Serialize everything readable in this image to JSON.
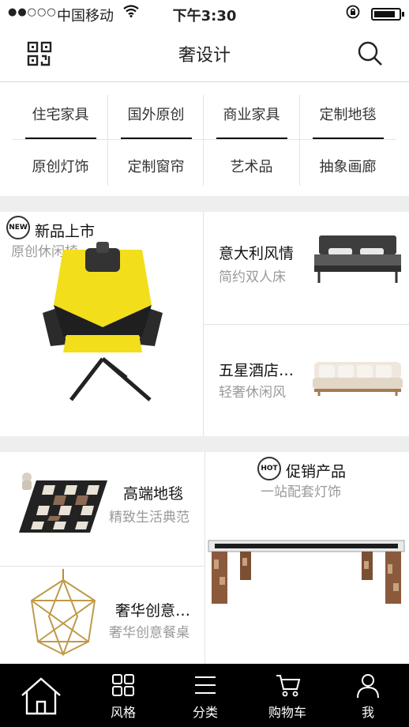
{
  "status_bar": {
    "signal": "●●○○○",
    "carrier": "中国移动",
    "time": "下午3:30"
  },
  "nav": {
    "title": "奢设计"
  },
  "categories": [
    {
      "label": "住宅家具"
    },
    {
      "label": "国外原创"
    },
    {
      "label": "商业家具"
    },
    {
      "label": "定制地毯"
    },
    {
      "label": "原创灯饰"
    },
    {
      "label": "定制窗帘"
    },
    {
      "label": "艺术品"
    },
    {
      "label": "抽象画廊"
    }
  ],
  "new_section": {
    "badge": "NEW",
    "title": "新品上市",
    "subtitle": "原创休闲椅",
    "items": [
      {
        "title": "意大利风情",
        "subtitle": "简约双人床"
      },
      {
        "title": "五星酒店…",
        "subtitle": "轻奢休闲风"
      }
    ]
  },
  "promo_section": {
    "badge": "HOT",
    "title": "促销产品",
    "subtitle": "一站配套灯饰",
    "items": [
      {
        "title": "高端地毯",
        "subtitle": "精致生活典范"
      },
      {
        "title": "奢华创意…",
        "subtitle": "奢华创意餐桌"
      }
    ]
  },
  "tabbar": {
    "items": [
      {
        "label": ""
      },
      {
        "label": "风格"
      },
      {
        "label": "分类"
      },
      {
        "label": "购物车"
      },
      {
        "label": "我"
      }
    ]
  },
  "colors": {
    "accent_yellow": "#f2de1a",
    "tabbar_bg": "#000000",
    "subtitle_gray": "#9a9a9a"
  }
}
